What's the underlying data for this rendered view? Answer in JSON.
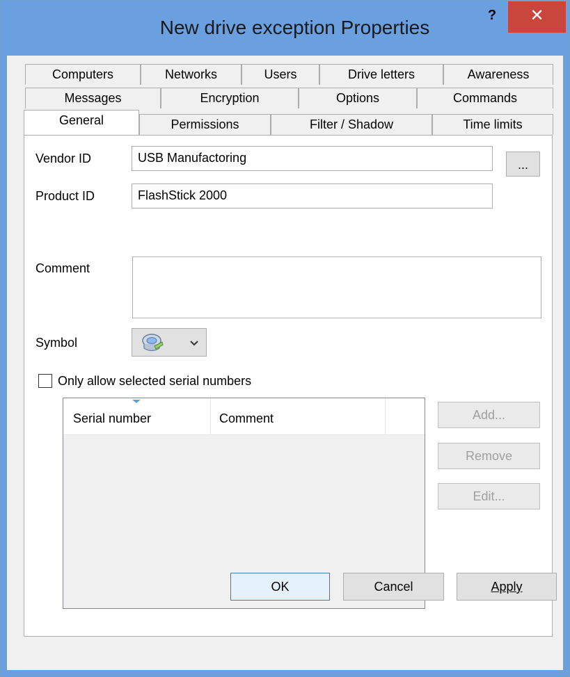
{
  "window": {
    "title": "New drive exception Properties",
    "help_label": "?",
    "close_label": "✕"
  },
  "tabs": {
    "row1": [
      "Computers",
      "Networks",
      "Users",
      "Drive letters",
      "Awareness"
    ],
    "row2": [
      "Messages",
      "Encryption",
      "Options",
      "Commands"
    ],
    "row3": [
      "General",
      "Permissions",
      "Filter / Shadow",
      "Time limits"
    ],
    "active": "General"
  },
  "general": {
    "vendor_label": "Vendor ID",
    "vendor_value": "USB Manufactoring",
    "browse_label": "...",
    "product_label": "Product ID",
    "product_value": "FlashStick 2000",
    "comment_label": "Comment",
    "comment_value": "",
    "symbol_label": "Symbol",
    "symbol_icon": "drive-icon",
    "only_allow_label": "Only allow selected serial numbers",
    "only_allow_checked": false
  },
  "serial_list": {
    "columns": [
      "Serial number",
      "Comment"
    ],
    "rows": []
  },
  "side_buttons": {
    "add": "Add...",
    "remove": "Remove",
    "edit": "Edit..."
  },
  "footer": {
    "ok": "OK",
    "cancel": "Cancel",
    "apply": "Apply"
  },
  "colors": {
    "titlebar": "#6aa0e0",
    "close_button": "#c9463d",
    "sort_arrow": "#5e9fd6"
  }
}
